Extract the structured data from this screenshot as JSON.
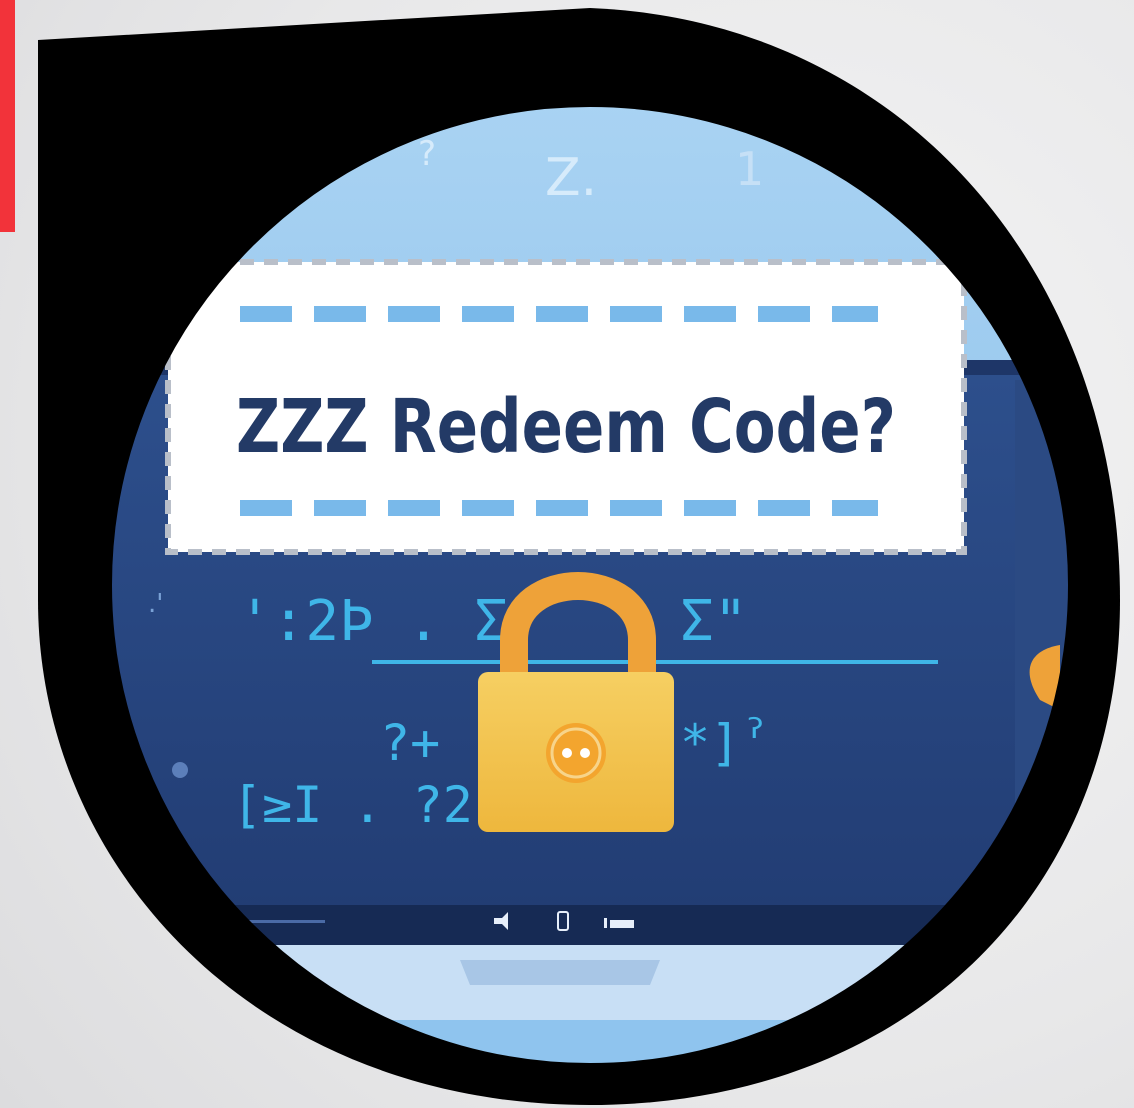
{
  "banner": {
    "title": "ZZZ Redeem Code?"
  },
  "floating_glyphs": [
    "?",
    "Z.",
    "1"
  ],
  "screen_code": {
    "line1": "':2Þ . Σ\"",
    "line1b": "Σ\"",
    "line2a": "?+",
    "line2b": "*]ˀ",
    "line3": "[≥Ι . ?2"
  },
  "icons": {
    "lock": "padlock-icon",
    "keyhole": "keyhole-icon",
    "taskbar": [
      "speaker-icon",
      "battery-icon",
      "signal-icon"
    ]
  },
  "colors": {
    "accent_red": "#f2333a",
    "frame_black": "#000000",
    "sky_blue": "#8fc4ee",
    "screen_navy": "#27457e",
    "title_navy": "#233a66",
    "dash_blue": "#79b9ea",
    "code_cyan": "#3fb6e8",
    "lock_gold": "#f1c24d",
    "shackle_orange": "#eea239"
  }
}
